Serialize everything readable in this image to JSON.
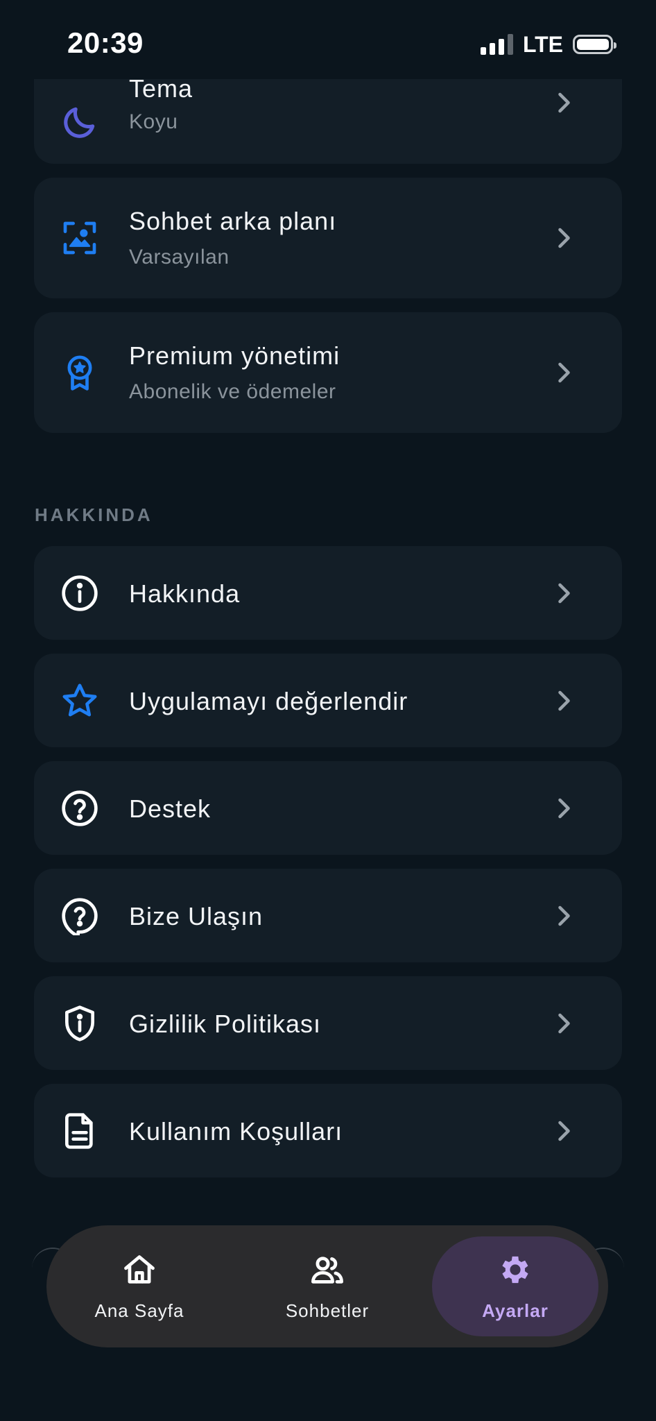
{
  "status_bar": {
    "time": "20:39",
    "network": "LTE"
  },
  "appearance": {
    "items": [
      {
        "title": "Tema",
        "subtitle": "Koyu",
        "icon": "moon-icon",
        "icon_color": "#5a5fd9"
      },
      {
        "title": "Sohbet arka planı",
        "subtitle": "Varsayılan",
        "icon": "wallpaper-icon",
        "icon_color": "#1f7ef2"
      },
      {
        "title": "Premium yönetimi",
        "subtitle": "Abonelik ve ödemeler",
        "icon": "premium-badge-icon",
        "icon_color": "#1f7ef2"
      }
    ]
  },
  "about_section": {
    "header": "HAKKINDA",
    "items": [
      {
        "title": "Hakkında",
        "icon": "info-icon"
      },
      {
        "title": "Uygulamayı değerlendir",
        "icon": "star-icon",
        "icon_color": "#1f7ef2"
      },
      {
        "title": "Destek",
        "icon": "help-circle-icon"
      },
      {
        "title": "Bize Ulaşın",
        "icon": "contact-help-icon"
      },
      {
        "title": "Gizlilik Politikası",
        "icon": "privacy-shield-icon"
      },
      {
        "title": "Kullanım Koşulları",
        "icon": "document-icon"
      }
    ]
  },
  "bottom_nav": {
    "items": [
      {
        "label": "Ana Sayfa",
        "icon": "home-icon",
        "active": false
      },
      {
        "label": "Sohbetler",
        "icon": "people-icon",
        "active": false
      },
      {
        "label": "Ayarlar",
        "icon": "gear-icon",
        "active": true
      }
    ],
    "active_color": "#c4a9f4"
  },
  "colors": {
    "background": "#0b151d",
    "card": "#131e27",
    "accent_blue": "#1f7ef2",
    "accent_indigo": "#5a5fd9"
  }
}
